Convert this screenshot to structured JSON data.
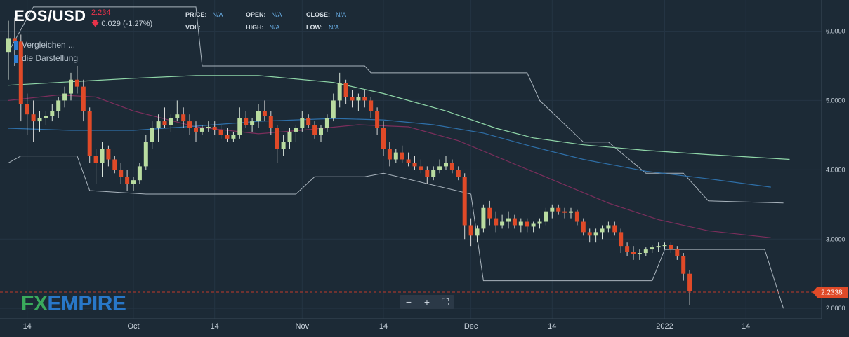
{
  "header": {
    "symbol": "EOS/USD",
    "last": "2.234",
    "change_arrow": "🡇",
    "change": "0.029 (-1.27%)"
  },
  "ohlc": {
    "price_label": "PRICE:",
    "price": "N/A",
    "open_label": "OPEN:",
    "open": "N/A",
    "close_label": "CLOSE:",
    "close": "N/A",
    "vol_label": "VOL:",
    "vol": "",
    "high_label": "HIGH:",
    "high": "N/A",
    "low_label": "LOW:",
    "low": "N/A"
  },
  "menu": {
    "compare": "Vergleichen ...",
    "display": "die Darstellung"
  },
  "logo": {
    "fx": "FX",
    "empire": "EMPIRE"
  },
  "toolbar": {
    "zoom_out": "−",
    "zoom_in": "+",
    "fullscreen": "⛶"
  },
  "colors": {
    "up": "#b9dca0",
    "down": "#e04a28",
    "bg": "#1c2a36",
    "ma_green": "#8fd6a8",
    "ma_blue": "#2e6fa8",
    "ma_purple": "#7c2e5c",
    "channel": "#a9b4bd"
  },
  "chart_data": {
    "type": "candlestick",
    "x_ticks": [
      {
        "label": "14",
        "i": 3
      },
      {
        "label": "Oct",
        "i": 20
      },
      {
        "label": "14",
        "i": 33
      },
      {
        "label": "Nov",
        "i": 47
      },
      {
        "label": "14",
        "i": 60
      },
      {
        "label": "Dec",
        "i": 74
      },
      {
        "label": "14",
        "i": 87
      },
      {
        "label": "2022",
        "i": 105
      },
      {
        "label": "14",
        "i": 118
      }
    ],
    "y_ticks": [
      "6.0000",
      "5.0000",
      "4.0000",
      "3.0000",
      "2.0000"
    ],
    "y_tick_values": [
      6,
      5,
      4,
      3,
      2
    ],
    "ylim": [
      1.85,
      6.45
    ],
    "current_price_label": "2.2338",
    "current_price": 2.2338,
    "candles": [
      [
        5.7,
        6.15,
        5.3,
        5.9
      ],
      [
        5.9,
        6.2,
        5.5,
        5.85
      ],
      [
        5.85,
        5.95,
        4.7,
        4.95
      ],
      [
        4.95,
        5.1,
        4.5,
        4.8
      ],
      [
        4.8,
        5.0,
        4.4,
        4.7
      ],
      [
        4.7,
        4.85,
        4.55,
        4.75
      ],
      [
        4.75,
        4.85,
        4.65,
        4.78
      ],
      [
        4.78,
        4.95,
        4.7,
        4.85
      ],
      [
        4.85,
        5.05,
        4.75,
        5.0
      ],
      [
        5.0,
        5.2,
        4.9,
        5.1
      ],
      [
        5.1,
        5.4,
        5.0,
        5.3
      ],
      [
        5.3,
        5.5,
        5.1,
        5.2
      ],
      [
        5.2,
        5.3,
        4.7,
        4.85
      ],
      [
        4.85,
        4.9,
        4.1,
        4.2
      ],
      [
        4.2,
        4.3,
        3.8,
        4.1
      ],
      [
        4.1,
        4.4,
        3.9,
        4.3
      ],
      [
        4.3,
        4.35,
        4.05,
        4.15
      ],
      [
        4.15,
        4.2,
        3.95,
        4.0
      ],
      [
        4.0,
        4.1,
        3.8,
        3.9
      ],
      [
        3.9,
        4.0,
        3.7,
        3.8
      ],
      [
        3.8,
        3.9,
        3.7,
        3.85
      ],
      [
        3.85,
        4.1,
        3.8,
        4.05
      ],
      [
        4.05,
        4.5,
        4.0,
        4.4
      ],
      [
        4.4,
        4.7,
        4.3,
        4.6
      ],
      [
        4.6,
        4.8,
        4.4,
        4.7
      ],
      [
        4.7,
        4.9,
        4.6,
        4.65
      ],
      [
        4.65,
        4.8,
        4.55,
        4.75
      ],
      [
        4.75,
        5.0,
        4.7,
        4.8
      ],
      [
        4.8,
        4.9,
        4.6,
        4.7
      ],
      [
        4.7,
        4.8,
        4.5,
        4.6
      ],
      [
        4.6,
        4.7,
        4.4,
        4.55
      ],
      [
        4.55,
        4.65,
        4.5,
        4.6
      ],
      [
        4.6,
        4.7,
        4.55,
        4.62
      ],
      [
        4.62,
        4.7,
        4.5,
        4.58
      ],
      [
        4.58,
        4.65,
        4.45,
        4.5
      ],
      [
        4.5,
        4.6,
        4.4,
        4.45
      ],
      [
        4.45,
        4.55,
        4.4,
        4.5
      ],
      [
        4.5,
        4.9,
        4.45,
        4.75
      ],
      [
        4.75,
        4.85,
        4.6,
        4.65
      ],
      [
        4.65,
        4.75,
        4.55,
        4.7
      ],
      [
        4.7,
        4.95,
        4.6,
        4.85
      ],
      [
        4.85,
        5.0,
        4.7,
        4.78
      ],
      [
        4.78,
        4.85,
        4.5,
        4.6
      ],
      [
        4.6,
        4.65,
        4.1,
        4.3
      ],
      [
        4.3,
        4.5,
        4.2,
        4.4
      ],
      [
        4.4,
        4.6,
        4.3,
        4.55
      ],
      [
        4.55,
        4.65,
        4.4,
        4.6
      ],
      [
        4.6,
        4.85,
        4.55,
        4.75
      ],
      [
        4.75,
        4.8,
        4.6,
        4.65
      ],
      [
        4.65,
        4.7,
        4.45,
        4.5
      ],
      [
        4.5,
        4.65,
        4.4,
        4.6
      ],
      [
        4.6,
        4.8,
        4.55,
        4.75
      ],
      [
        4.75,
        5.1,
        4.7,
        5.0
      ],
      [
        5.0,
        5.4,
        4.9,
        5.25
      ],
      [
        5.25,
        5.3,
        4.95,
        5.05
      ],
      [
        5.05,
        5.15,
        4.9,
        5.0
      ],
      [
        5.0,
        5.1,
        4.85,
        5.05
      ],
      [
        5.05,
        5.15,
        4.9,
        5.0
      ],
      [
        5.0,
        5.05,
        4.75,
        4.85
      ],
      [
        4.85,
        4.9,
        4.5,
        4.6
      ],
      [
        4.6,
        4.7,
        4.2,
        4.3
      ],
      [
        4.3,
        4.4,
        4.05,
        4.15
      ],
      [
        4.15,
        4.3,
        4.1,
        4.25
      ],
      [
        4.25,
        4.35,
        4.1,
        4.15
      ],
      [
        4.15,
        4.25,
        4.05,
        4.1
      ],
      [
        4.1,
        4.2,
        4.0,
        4.05
      ],
      [
        4.05,
        4.15,
        3.95,
        4.0
      ],
      [
        4.0,
        4.05,
        3.8,
        3.9
      ],
      [
        3.9,
        4.05,
        3.85,
        4.0
      ],
      [
        4.0,
        4.15,
        3.95,
        4.05
      ],
      [
        4.05,
        4.2,
        4.0,
        4.1
      ],
      [
        4.1,
        4.15,
        3.95,
        4.0
      ],
      [
        4.0,
        4.05,
        3.85,
        3.9
      ],
      [
        3.9,
        3.95,
        3.0,
        3.2
      ],
      [
        3.2,
        3.3,
        2.9,
        3.05
      ],
      [
        3.05,
        3.2,
        2.95,
        3.15
      ],
      [
        3.15,
        3.5,
        3.1,
        3.45
      ],
      [
        3.45,
        3.55,
        3.2,
        3.3
      ],
      [
        3.3,
        3.4,
        3.1,
        3.2
      ],
      [
        3.2,
        3.35,
        3.15,
        3.25
      ],
      [
        3.25,
        3.4,
        3.15,
        3.3
      ],
      [
        3.3,
        3.35,
        3.15,
        3.2
      ],
      [
        3.2,
        3.3,
        3.1,
        3.25
      ],
      [
        3.25,
        3.3,
        3.1,
        3.18
      ],
      [
        3.18,
        3.25,
        3.1,
        3.22
      ],
      [
        3.22,
        3.3,
        3.15,
        3.25
      ],
      [
        3.25,
        3.45,
        3.2,
        3.4
      ],
      [
        3.4,
        3.5,
        3.3,
        3.45
      ],
      [
        3.45,
        3.5,
        3.35,
        3.4
      ],
      [
        3.4,
        3.45,
        3.3,
        3.38
      ],
      [
        3.38,
        3.45,
        3.3,
        3.4
      ],
      [
        3.4,
        3.42,
        3.2,
        3.25
      ],
      [
        3.25,
        3.3,
        3.05,
        3.1
      ],
      [
        3.1,
        3.15,
        2.95,
        3.05
      ],
      [
        3.05,
        3.15,
        2.95,
        3.1
      ],
      [
        3.1,
        3.2,
        3.0,
        3.15
      ],
      [
        3.15,
        3.25,
        3.1,
        3.2
      ],
      [
        3.2,
        3.25,
        3.05,
        3.1
      ],
      [
        3.1,
        3.15,
        2.8,
        2.9
      ],
      [
        2.9,
        2.95,
        2.75,
        2.82
      ],
      [
        2.82,
        2.9,
        2.7,
        2.78
      ],
      [
        2.78,
        2.85,
        2.7,
        2.8
      ],
      [
        2.8,
        2.88,
        2.75,
        2.85
      ],
      [
        2.85,
        2.92,
        2.8,
        2.88
      ],
      [
        2.88,
        2.95,
        2.82,
        2.9
      ],
      [
        2.9,
        2.95,
        2.85,
        2.92
      ],
      [
        2.92,
        2.95,
        2.8,
        2.85
      ],
      [
        2.85,
        2.9,
        2.7,
        2.75
      ],
      [
        2.75,
        2.8,
        2.4,
        2.5
      ],
      [
        2.5,
        2.55,
        2.05,
        2.25
      ]
    ],
    "ma_green": [
      [
        0,
        5.22
      ],
      [
        10,
        5.27
      ],
      [
        20,
        5.32
      ],
      [
        30,
        5.36
      ],
      [
        40,
        5.36
      ],
      [
        52,
        5.26
      ],
      [
        60,
        5.1
      ],
      [
        70,
        4.85
      ],
      [
        78,
        4.6
      ],
      [
        84,
        4.46
      ],
      [
        92,
        4.36
      ],
      [
        102,
        4.28
      ],
      [
        112,
        4.22
      ],
      [
        125,
        4.15
      ]
    ],
    "ma_blue": [
      [
        0,
        4.6
      ],
      [
        10,
        4.57
      ],
      [
        20,
        4.57
      ],
      [
        30,
        4.63
      ],
      [
        40,
        4.7
      ],
      [
        52,
        4.74
      ],
      [
        60,
        4.72
      ],
      [
        68,
        4.65
      ],
      [
        76,
        4.53
      ],
      [
        84,
        4.33
      ],
      [
        92,
        4.15
      ],
      [
        102,
        3.98
      ],
      [
        112,
        3.87
      ],
      [
        122,
        3.75
      ]
    ],
    "ma_purple": [
      [
        0,
        5.0
      ],
      [
        8,
        5.08
      ],
      [
        14,
        5.05
      ],
      [
        20,
        4.85
      ],
      [
        30,
        4.62
      ],
      [
        40,
        4.52
      ],
      [
        48,
        4.58
      ],
      [
        56,
        4.65
      ],
      [
        64,
        4.62
      ],
      [
        72,
        4.42
      ],
      [
        80,
        4.12
      ],
      [
        88,
        3.82
      ],
      [
        96,
        3.52
      ],
      [
        104,
        3.28
      ],
      [
        112,
        3.12
      ],
      [
        122,
        3.02
      ]
    ],
    "channel_upper": [
      [
        0,
        5.7
      ],
      [
        4,
        6.35
      ],
      [
        30,
        6.35
      ],
      [
        31,
        5.5
      ],
      [
        57,
        5.5
      ],
      [
        58,
        5.4
      ],
      [
        83,
        5.4
      ],
      [
        85,
        5.0
      ],
      [
        92,
        4.4
      ],
      [
        96,
        4.4
      ],
      [
        102,
        3.95
      ],
      [
        108,
        3.95
      ],
      [
        112,
        3.55
      ],
      [
        124,
        3.52
      ]
    ],
    "channel_lower": [
      [
        0,
        4.1
      ],
      [
        2,
        4.2
      ],
      [
        11,
        4.2
      ],
      [
        13,
        3.7
      ],
      [
        22,
        3.65
      ],
      [
        23,
        3.65
      ],
      [
        46,
        3.65
      ],
      [
        49,
        3.9
      ],
      [
        57,
        3.9
      ],
      [
        60,
        3.95
      ],
      [
        74,
        3.65
      ],
      [
        76,
        2.4
      ],
      [
        103,
        2.4
      ],
      [
        105,
        2.85
      ],
      [
        121,
        2.85
      ],
      [
        124,
        2.0
      ]
    ],
    "channel_mid": [
      [
        0,
        4.0
      ],
      [
        6,
        4.6
      ],
      [
        14,
        4.8
      ],
      [
        24,
        4.6
      ],
      [
        36,
        4.5
      ],
      [
        48,
        4.6
      ],
      [
        60,
        4.6
      ],
      [
        70,
        4.2
      ],
      [
        78,
        3.7
      ],
      [
        86,
        3.35
      ],
      [
        96,
        3.2
      ],
      [
        104,
        3.0
      ],
      [
        112,
        2.75
      ],
      [
        122,
        2.75
      ]
    ]
  }
}
